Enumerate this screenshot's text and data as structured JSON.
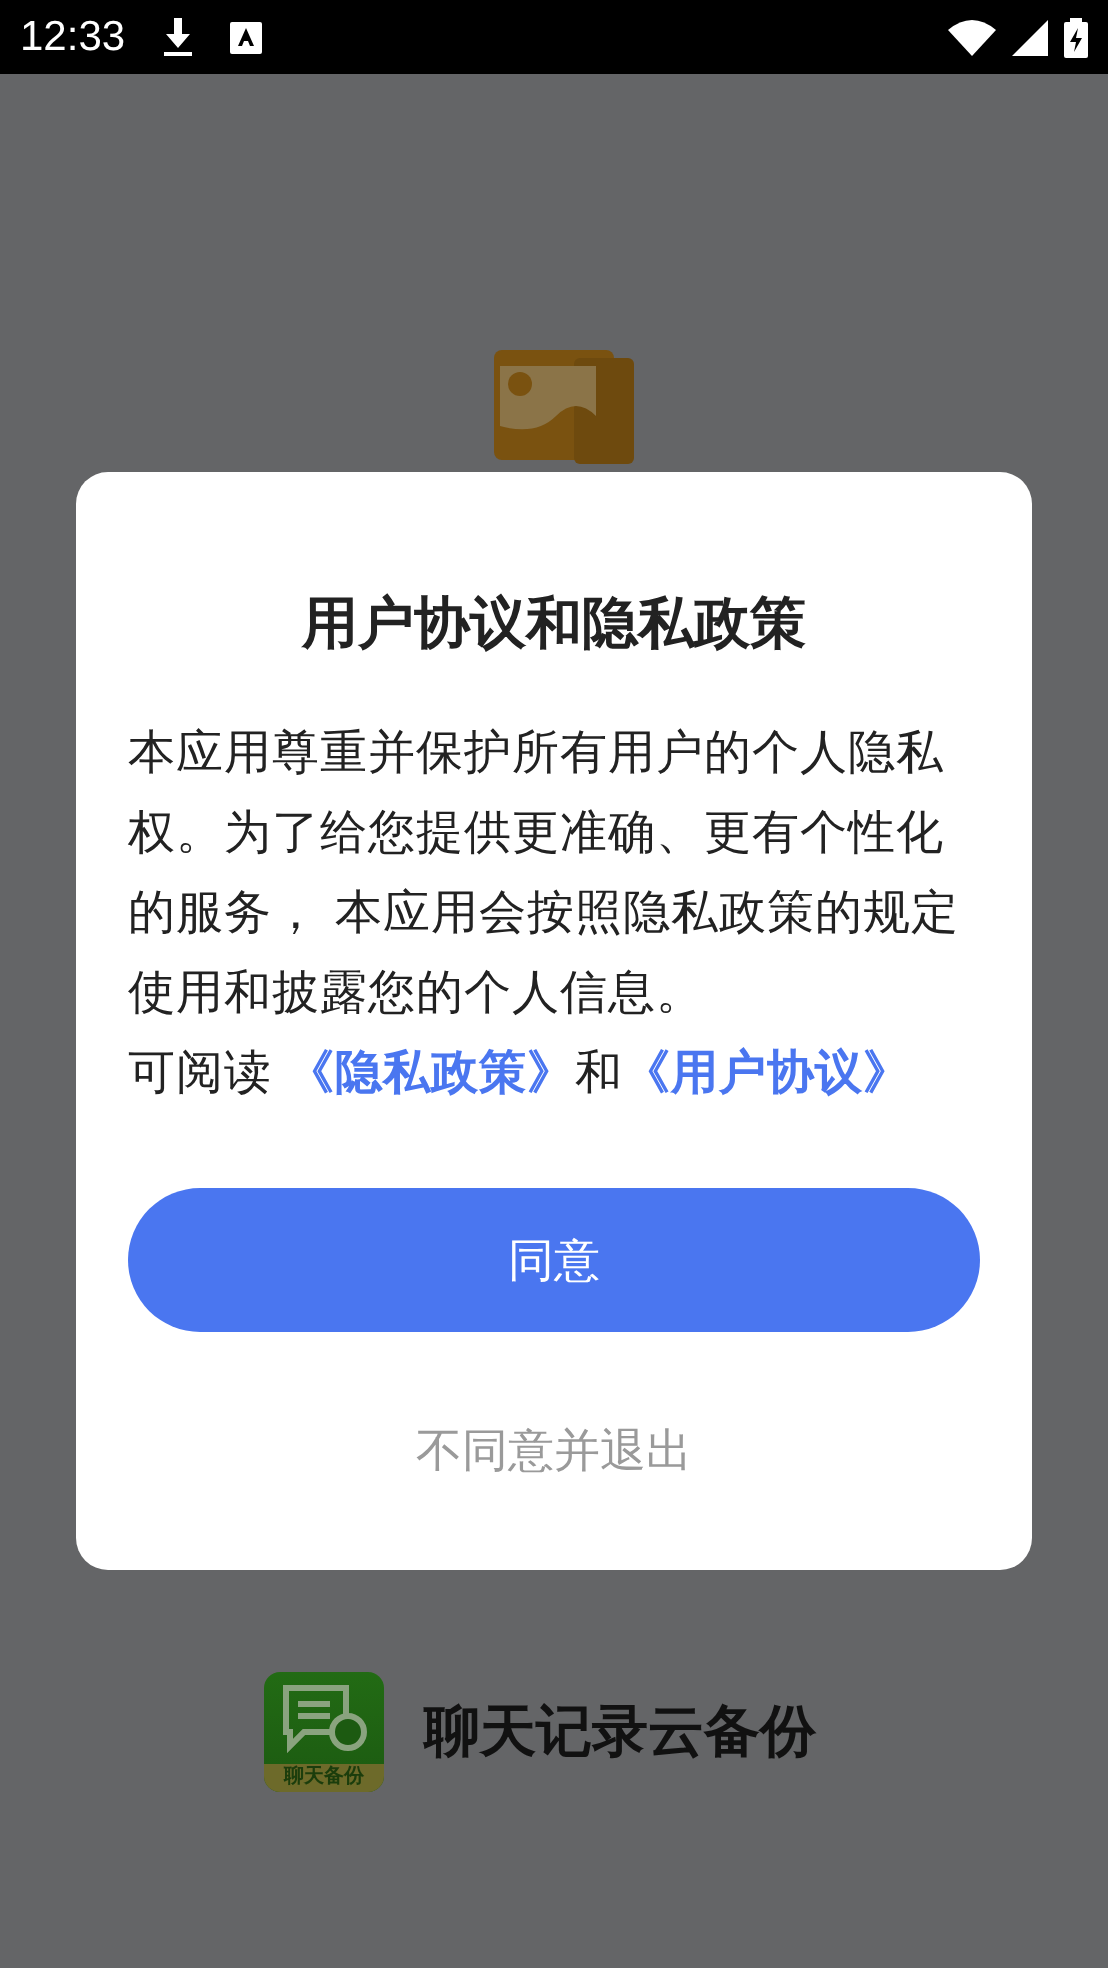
{
  "status_bar": {
    "time": "12:33"
  },
  "splash": {
    "app_name": "聊天记录云备份",
    "app_icon_label": "聊天备份"
  },
  "dialog": {
    "title": "用户协议和隐私政策",
    "body": "本应用尊重并保护所有用户的个人隐私权。为了给您提供更准确、更有个性化的服务， 本应用会按照隐私政策的规定使用和披露您的个人信息。",
    "read_line": {
      "prefix": "可阅读 ",
      "privacy_link": "《隐私政策》",
      "joiner": "和",
      "terms_link": "《用户协议》"
    },
    "agree_button": "同意",
    "decline_button": "不同意并退出"
  }
}
